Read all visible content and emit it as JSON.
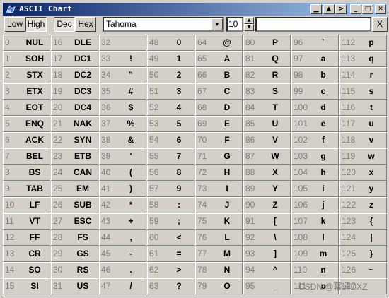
{
  "window": {
    "title": "ASCII Chart",
    "controls": [
      "minimize-icon",
      "restore-icon",
      "pin-icon",
      "close-icon"
    ]
  },
  "toolbar": {
    "low_label": "Low",
    "high_label": "High",
    "dec_label": "Dec",
    "hex_label": "Hex",
    "font_name": "Tahoma",
    "font_size": "10",
    "search_value": "",
    "close_label": "X"
  },
  "columns": [
    {
      "cells": [
        {
          "code": "0",
          "char": "NUL"
        },
        {
          "code": "1",
          "char": "SOH"
        },
        {
          "code": "2",
          "char": "STX"
        },
        {
          "code": "3",
          "char": "ETX"
        },
        {
          "code": "4",
          "char": "EOT"
        },
        {
          "code": "5",
          "char": "ENQ"
        },
        {
          "code": "6",
          "char": "ACK"
        },
        {
          "code": "7",
          "char": "BEL"
        },
        {
          "code": "8",
          "char": "BS"
        },
        {
          "code": "9",
          "char": "TAB"
        },
        {
          "code": "10",
          "char": "LF"
        },
        {
          "code": "11",
          "char": "VT"
        },
        {
          "code": "12",
          "char": "FF"
        },
        {
          "code": "13",
          "char": "CR"
        },
        {
          "code": "14",
          "char": "SO"
        },
        {
          "code": "15",
          "char": "SI"
        }
      ]
    },
    {
      "cells": [
        {
          "code": "16",
          "char": "DLE"
        },
        {
          "code": "17",
          "char": "DC1"
        },
        {
          "code": "18",
          "char": "DC2"
        },
        {
          "code": "19",
          "char": "DC3"
        },
        {
          "code": "20",
          "char": "DC4"
        },
        {
          "code": "21",
          "char": "NAK"
        },
        {
          "code": "22",
          "char": "SYN"
        },
        {
          "code": "23",
          "char": "ETB"
        },
        {
          "code": "24",
          "char": "CAN"
        },
        {
          "code": "25",
          "char": "EM"
        },
        {
          "code": "26",
          "char": "SUB"
        },
        {
          "code": "27",
          "char": "ESC"
        },
        {
          "code": "28",
          "char": "FS"
        },
        {
          "code": "29",
          "char": "GS"
        },
        {
          "code": "30",
          "char": "RS"
        },
        {
          "code": "31",
          "char": "US"
        }
      ]
    },
    {
      "cells": [
        {
          "code": "32",
          "char": ""
        },
        {
          "code": "33",
          "char": "!"
        },
        {
          "code": "34",
          "char": "\""
        },
        {
          "code": "35",
          "char": "#"
        },
        {
          "code": "36",
          "char": "$"
        },
        {
          "code": "37",
          "char": "%"
        },
        {
          "code": "38",
          "char": "&"
        },
        {
          "code": "39",
          "char": "'"
        },
        {
          "code": "40",
          "char": "("
        },
        {
          "code": "41",
          "char": ")"
        },
        {
          "code": "42",
          "char": "*"
        },
        {
          "code": "43",
          "char": "+"
        },
        {
          "code": "44",
          "char": ","
        },
        {
          "code": "45",
          "char": "-"
        },
        {
          "code": "46",
          "char": "."
        },
        {
          "code": "47",
          "char": "/"
        }
      ]
    },
    {
      "cells": [
        {
          "code": "48",
          "char": "0"
        },
        {
          "code": "49",
          "char": "1"
        },
        {
          "code": "50",
          "char": "2"
        },
        {
          "code": "51",
          "char": "3"
        },
        {
          "code": "52",
          "char": "4"
        },
        {
          "code": "53",
          "char": "5"
        },
        {
          "code": "54",
          "char": "6"
        },
        {
          "code": "55",
          "char": "7"
        },
        {
          "code": "56",
          "char": "8"
        },
        {
          "code": "57",
          "char": "9"
        },
        {
          "code": "58",
          "char": ":"
        },
        {
          "code": "59",
          "char": ";"
        },
        {
          "code": "60",
          "char": "<"
        },
        {
          "code": "61",
          "char": "="
        },
        {
          "code": "62",
          "char": ">"
        },
        {
          "code": "63",
          "char": "?"
        }
      ]
    },
    {
      "cells": [
        {
          "code": "64",
          "char": "@"
        },
        {
          "code": "65",
          "char": "A"
        },
        {
          "code": "66",
          "char": "B"
        },
        {
          "code": "67",
          "char": "C"
        },
        {
          "code": "68",
          "char": "D"
        },
        {
          "code": "69",
          "char": "E"
        },
        {
          "code": "70",
          "char": "F"
        },
        {
          "code": "71",
          "char": "G"
        },
        {
          "code": "72",
          "char": "H"
        },
        {
          "code": "73",
          "char": "I"
        },
        {
          "code": "74",
          "char": "J"
        },
        {
          "code": "75",
          "char": "K"
        },
        {
          "code": "76",
          "char": "L"
        },
        {
          "code": "77",
          "char": "M"
        },
        {
          "code": "78",
          "char": "N"
        },
        {
          "code": "79",
          "char": "O"
        }
      ]
    },
    {
      "cells": [
        {
          "code": "80",
          "char": "P"
        },
        {
          "code": "81",
          "char": "Q"
        },
        {
          "code": "82",
          "char": "R"
        },
        {
          "code": "83",
          "char": "S"
        },
        {
          "code": "84",
          "char": "T"
        },
        {
          "code": "85",
          "char": "U"
        },
        {
          "code": "86",
          "char": "V"
        },
        {
          "code": "87",
          "char": "W"
        },
        {
          "code": "88",
          "char": "X"
        },
        {
          "code": "89",
          "char": "Y"
        },
        {
          "code": "90",
          "char": "Z"
        },
        {
          "code": "91",
          "char": "["
        },
        {
          "code": "92",
          "char": "\\"
        },
        {
          "code": "93",
          "char": "]"
        },
        {
          "code": "94",
          "char": "^"
        },
        {
          "code": "95",
          "char": "_"
        }
      ]
    },
    {
      "cells": [
        {
          "code": "96",
          "char": "`"
        },
        {
          "code": "97",
          "char": "a"
        },
        {
          "code": "98",
          "char": "b"
        },
        {
          "code": "99",
          "char": "c"
        },
        {
          "code": "100",
          "char": "d"
        },
        {
          "code": "101",
          "char": "e"
        },
        {
          "code": "102",
          "char": "f"
        },
        {
          "code": "103",
          "char": "g"
        },
        {
          "code": "104",
          "char": "h"
        },
        {
          "code": "105",
          "char": "i"
        },
        {
          "code": "106",
          "char": "j"
        },
        {
          "code": "107",
          "char": "k"
        },
        {
          "code": "108",
          "char": "l"
        },
        {
          "code": "109",
          "char": "m"
        },
        {
          "code": "110",
          "char": "n"
        },
        {
          "code": "111",
          "char": "o"
        }
      ]
    },
    {
      "cells": [
        {
          "code": "112",
          "char": "p"
        },
        {
          "code": "113",
          "char": "q"
        },
        {
          "code": "114",
          "char": "r"
        },
        {
          "code": "115",
          "char": "s"
        },
        {
          "code": "116",
          "char": "t"
        },
        {
          "code": "117",
          "char": "u"
        },
        {
          "code": "118",
          "char": "v"
        },
        {
          "code": "119",
          "char": "w"
        },
        {
          "code": "120",
          "char": "x"
        },
        {
          "code": "121",
          "char": "y"
        },
        {
          "code": "122",
          "char": "z"
        },
        {
          "code": "123",
          "char": "{"
        },
        {
          "code": "124",
          "char": "|"
        },
        {
          "code": "125",
          "char": "}"
        },
        {
          "code": "126",
          "char": "~"
        },
        {
          "code": "127",
          "char": ""
        }
      ]
    }
  ],
  "watermark": "CSDN @幂通DXZ",
  "colors": {
    "title_gradient_start": "#0a246a",
    "title_gradient_end": "#a6caf0",
    "face": "#d4d0c8",
    "code_text": "#808080"
  }
}
